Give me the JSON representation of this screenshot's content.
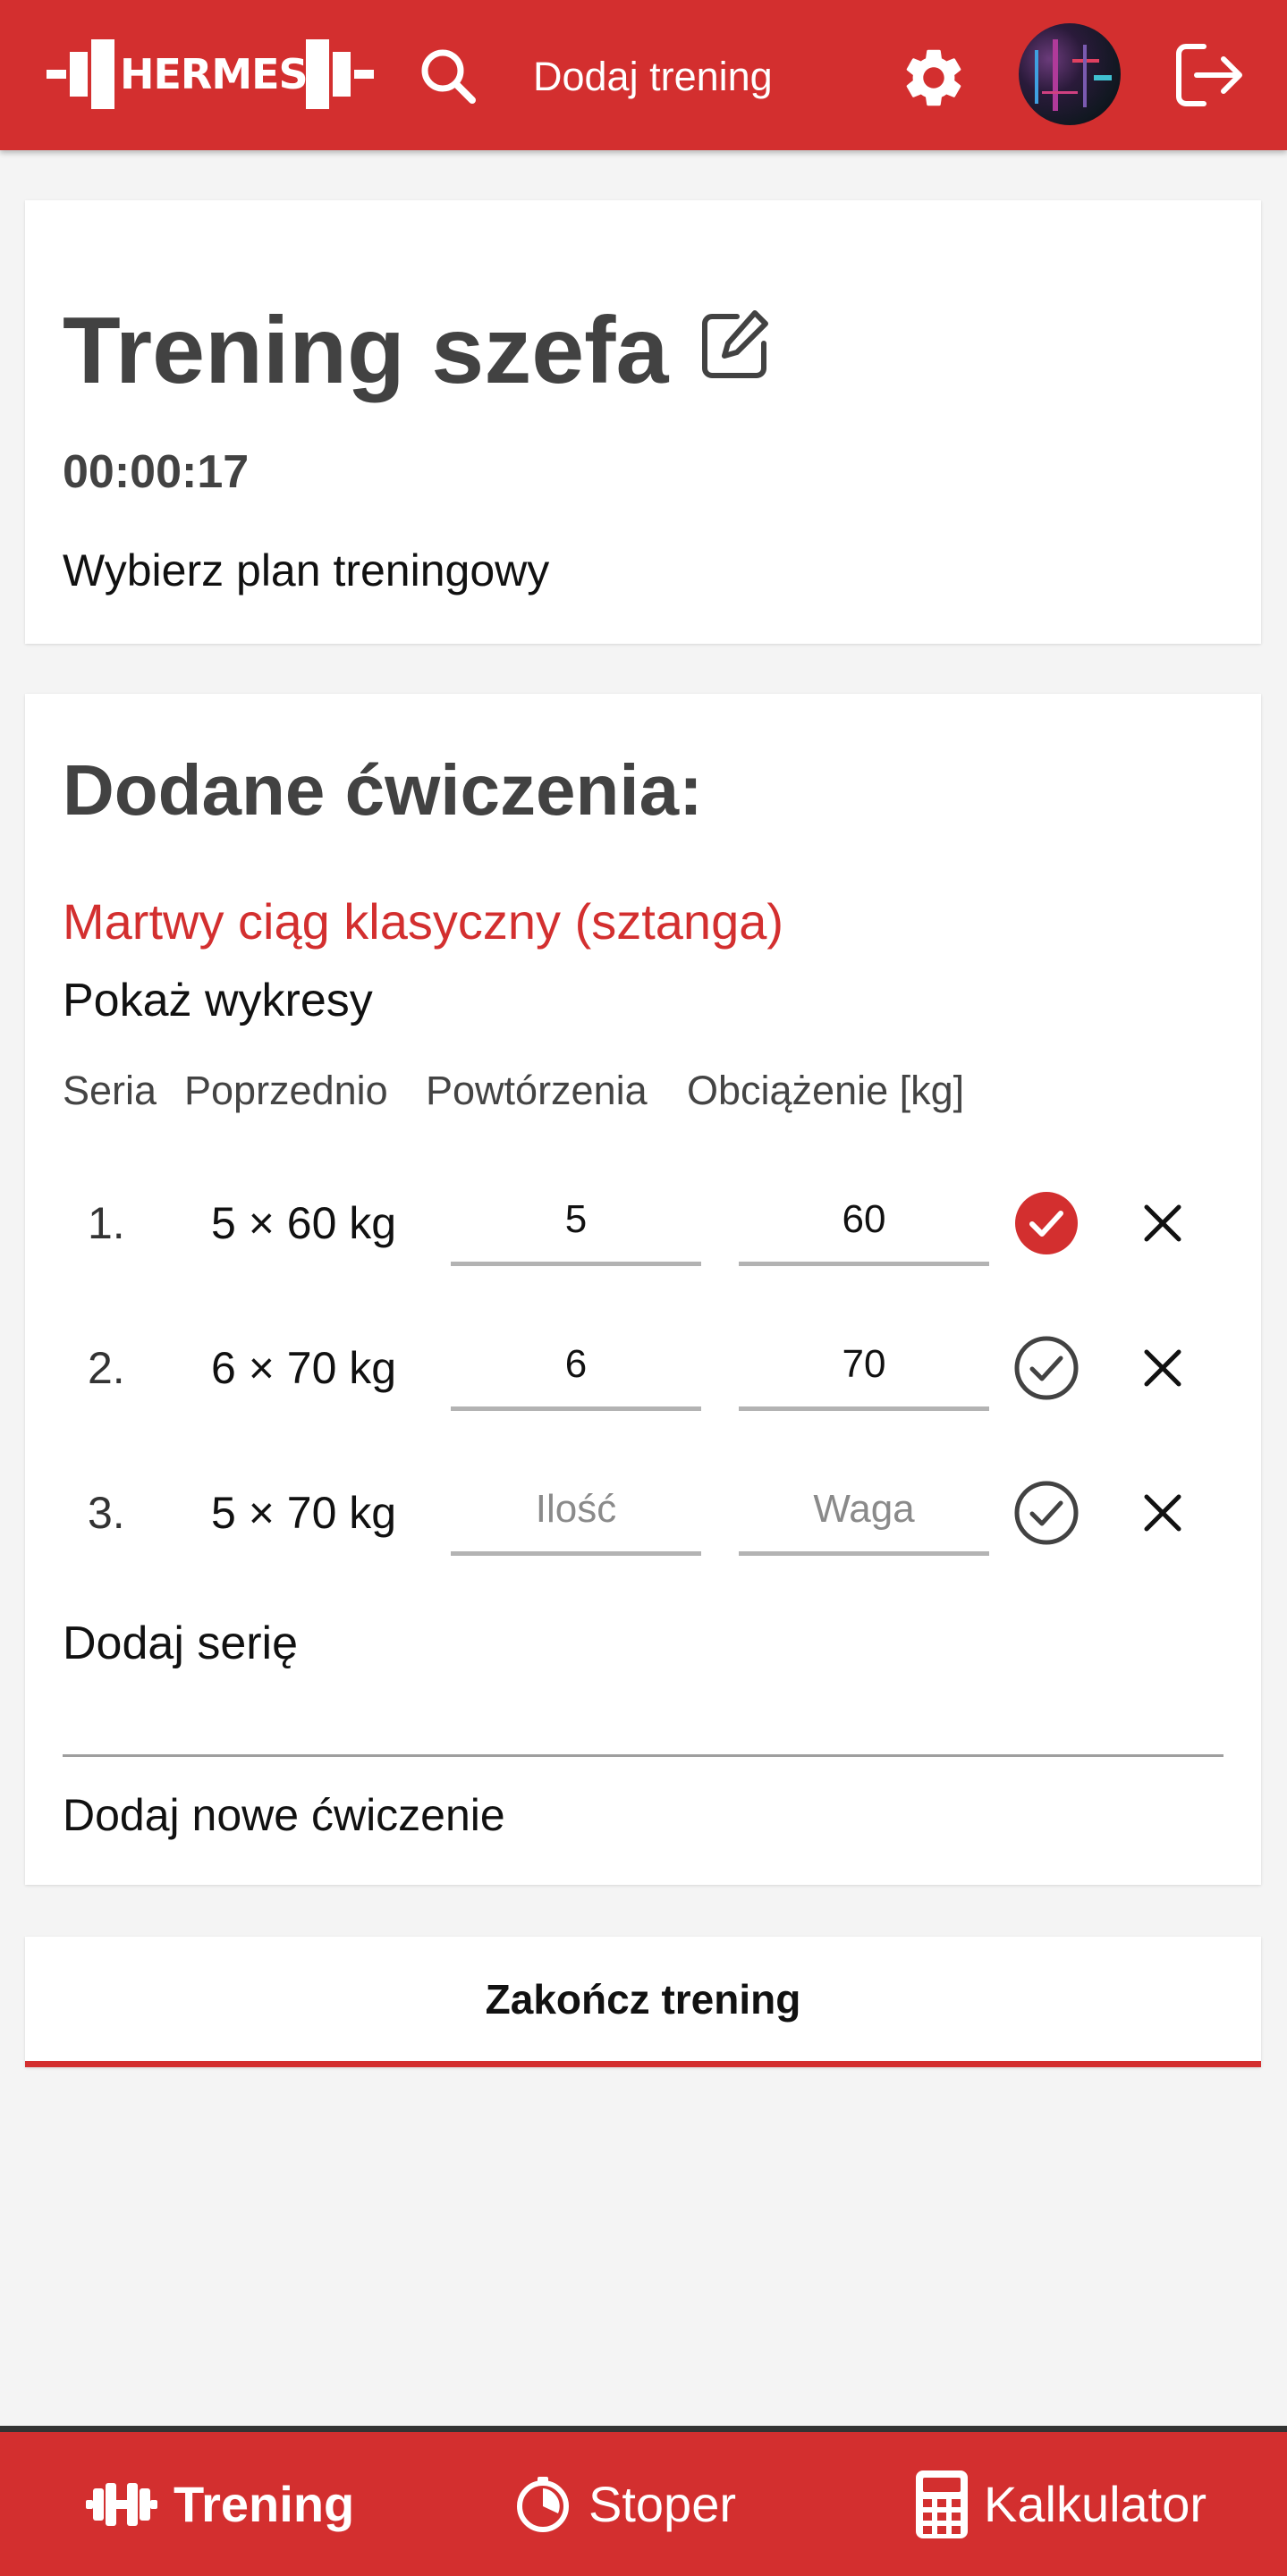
{
  "header": {
    "logo_text": "HERMES",
    "add_training_label": "Dodaj trening"
  },
  "workout": {
    "title": "Trening szefa",
    "timer": "00:00:17",
    "choose_plan_label": "Wybierz plan treningowy"
  },
  "exercises_section": {
    "title": "Dodane ćwiczenia:",
    "exercise_name": "Martwy ciąg klasyczny (sztanga)",
    "show_charts_label": "Pokaż wykresy",
    "columns": [
      "Seria",
      "Poprzednio",
      "Powtórzenia",
      "Obciążenie [kg]"
    ],
    "sets": [
      {
        "number": "1.",
        "previous": "5 × 60 kg",
        "reps": "5",
        "weight": "60",
        "completed": true
      },
      {
        "number": "2.",
        "previous": "6 × 70 kg",
        "reps": "6",
        "weight": "70",
        "completed": false
      },
      {
        "number": "3.",
        "previous": "5 × 70 kg",
        "reps": "",
        "weight": "",
        "completed": false
      }
    ],
    "reps_placeholder": "Ilość",
    "weight_placeholder": "Waga",
    "add_set_label": "Dodaj serię",
    "add_exercise_label": "Dodaj nowe ćwiczenie"
  },
  "finish_button_label": "Zakończ trening",
  "bottom_nav": {
    "items": [
      {
        "label": "Trening",
        "icon": "dumbbell-icon",
        "active": true
      },
      {
        "label": "Stoper",
        "icon": "stopwatch-icon",
        "active": false
      },
      {
        "label": "Kalkulator",
        "icon": "calculator-icon",
        "active": false
      }
    ]
  },
  "colors": {
    "primary": "#d32f2f",
    "background": "#f4f4f4",
    "card": "#ffffff",
    "heading_text": "#424242"
  }
}
